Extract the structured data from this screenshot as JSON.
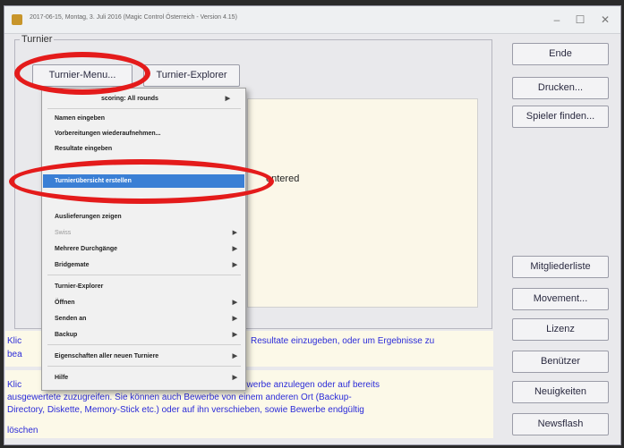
{
  "window": {
    "title": "2017-06-15, Montag, 3. Juli 2016 (Magic Control Österreich - Version 4.15)",
    "controls": {
      "minimize": "–",
      "maximize": "☐",
      "close": "✕"
    }
  },
  "group": {
    "label": "Turnier"
  },
  "tabs": {
    "menu_label": "Turnier-Menu...",
    "explorer_label": "Turnier-Explorer"
  },
  "right_buttons": {
    "ende": "Ende",
    "drucken": "Drucken...",
    "spieler_finden": "Spieler finden...",
    "mitgliederliste": "Mitgliederliste",
    "movement": "Movement...",
    "lizenz": "Lizenz",
    "benutzer": "Benützer",
    "neuigkeiten": "Neuigkeiten",
    "newsflash": "Newsflash"
  },
  "panel": {
    "text": "entered",
    "header_fragment": "scoring: All rounds"
  },
  "menu": {
    "items": [
      {
        "label": "Namen eingeben",
        "submenu": false,
        "state": "normal"
      },
      {
        "label": "Vorbereitungen wiederaufnehmen...",
        "submenu": false,
        "state": "normal"
      },
      {
        "label": "Resultate eingeben",
        "submenu": false,
        "state": "normal"
      },
      {
        "label": "Turnierübersicht erstellen",
        "submenu": false,
        "state": "selected"
      },
      {
        "label": "Auslieferungen zeigen",
        "submenu": false,
        "state": "normal"
      },
      {
        "label": "Swiss",
        "submenu": true,
        "state": "disabled"
      },
      {
        "label": "Mehrere Durchgänge",
        "submenu": true,
        "state": "normal"
      },
      {
        "label": "Bridgemate",
        "submenu": true,
        "state": "normal"
      },
      {
        "label": "Turnier-Explorer",
        "submenu": false,
        "state": "normal"
      },
      {
        "label": "Öffnen",
        "submenu": true,
        "state": "normal"
      },
      {
        "label": "Senden an",
        "submenu": true,
        "state": "normal"
      },
      {
        "label": "Backup",
        "submenu": true,
        "state": "normal"
      },
      {
        "label": "Eigenschaften aller neuen Turniere",
        "submenu": true,
        "state": "normal"
      },
      {
        "label": "Hilfe",
        "submenu": true,
        "state": "normal"
      }
    ]
  },
  "info": {
    "line1_prefix": "Klic",
    "line1_suffix": "Resultate einzugeben, oder um Ergebnisse zu",
    "line2_prefix": "bea",
    "para2_prefix": "Klic",
    "para2_line1": "ewerbe anzulegen oder auf bereits",
    "para2_line2": "ausgewertete zuzugreifen. Sie können auch Bewerbe von einem anderen Ort (Backup-",
    "para2_line3": "Directory, Diskette, Memory-Stick etc.) oder auf ihn verschieben, sowie Bewerbe endgültig",
    "para2_line4": "löschen"
  },
  "colors": {
    "highlight": "#e41b1b",
    "selection": "#3a7fd5",
    "info_text": "#2b2bd8"
  }
}
